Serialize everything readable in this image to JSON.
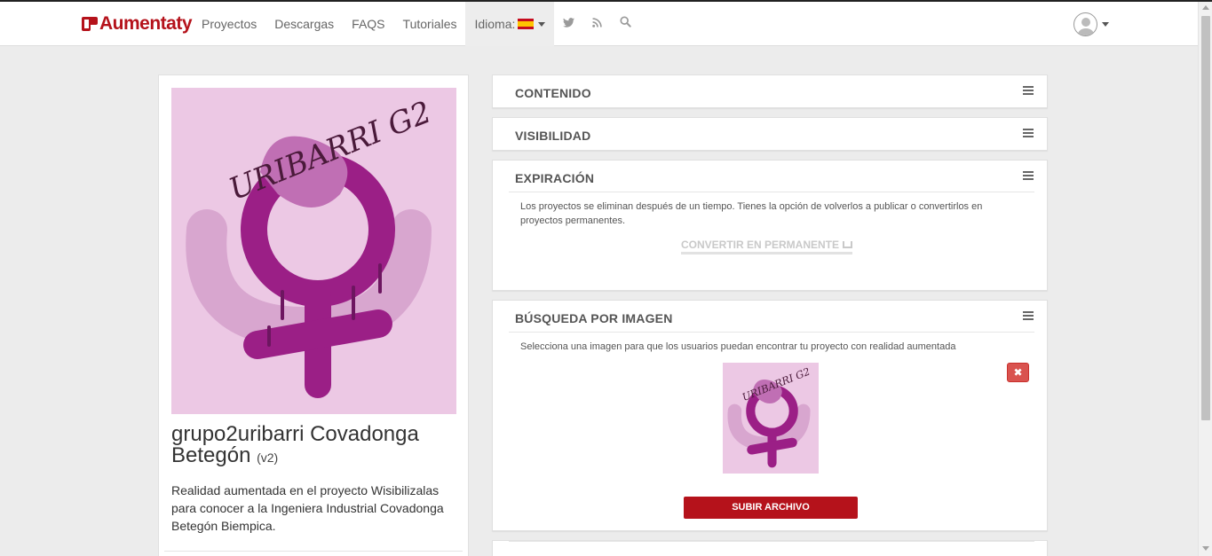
{
  "brand": {
    "name": "Aumentaty",
    "accent_color": "#b5121b"
  },
  "nav": {
    "items": [
      "Proyectos",
      "Descargas",
      "FAQS",
      "Tutoriales"
    ],
    "language_label": "Idioma:",
    "language_flag": "spain-flag-icon",
    "icons": [
      "twitter-icon",
      "rss-icon",
      "search-icon"
    ]
  },
  "user": {
    "icon": "user-avatar-icon"
  },
  "project": {
    "title": "grupo2uribarri Covadonga Betegón",
    "version": "(v2)",
    "description": "Realidad aumentada en el proyecto Wisibilizalas para conocer a la Ingeniera Industrial Covadonga Betegón Biempica.",
    "cover_text": "URIBARRI G2"
  },
  "panels": {
    "contenido": {
      "title": "CONTENIDO"
    },
    "visibilidad": {
      "title": "VISIBILIDAD"
    },
    "expiracion": {
      "title": "EXPIRACIÓN",
      "text": "Los proyectos se eliminan después de un tiempo. Tienes la opción de volverlos a publicar o convertirlos en proyectos permanentes.",
      "convert_label": "CONVERTIR EN PERMANENTE"
    },
    "busqueda": {
      "title": "BÚSQUEDA POR IMAGEN",
      "text": "Selecciona una imagen para que los usuarios puedan encontrar tu proyecto con realidad aumentada",
      "delete_label": "✖",
      "upload_label": "SUBIR ARCHIVO",
      "thumb_text": "URIBARRI G2"
    }
  }
}
